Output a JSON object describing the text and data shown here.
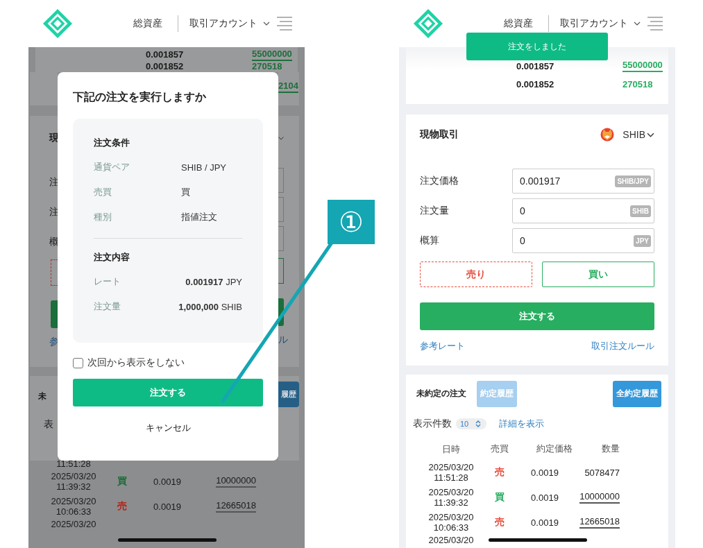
{
  "callout": {
    "label": "①"
  },
  "confirm_screen": {
    "header": {
      "nav": [
        "総資産",
        "取引アカウント"
      ]
    },
    "order_book": [
      {
        "price": "0.001857",
        "amount": "55000000",
        "link": true
      },
      {
        "price": "0.001852",
        "amount": "270518",
        "link": false
      }
    ],
    "left_edge": [
      "現",
      "注",
      "注",
      "概",
      "参",
      "未",
      "表"
    ],
    "right_edge": [
      "2104",
      "ル",
      "履歴"
    ],
    "dialog": {
      "title": "下記の注文を実行しますか",
      "sections": [
        {
          "heading": "注文条件",
          "rows": [
            {
              "label": "通貨ペア",
              "value": "SHIB / JPY"
            },
            {
              "label": "売買",
              "value": "買"
            },
            {
              "label": "種別",
              "value": "指値注文"
            }
          ]
        },
        {
          "heading": "注文内容",
          "rows": [
            {
              "label": "レート",
              "value": "**0.001917** JPY"
            },
            {
              "label": "注文量",
              "value": "**1,000,000** SHIB"
            }
          ]
        }
      ],
      "dont_show": {
        "label": "次回から表示をしない",
        "checked": false
      },
      "confirm": "注文する",
      "cancel": "キャンセル"
    },
    "table": {
      "partial_top": "11:51:28",
      "rows": [
        {
          "date": "2025/03/20",
          "time": "11:39:32",
          "side": "買",
          "kind": "buy",
          "price": "0.0019",
          "qty": "10000000",
          "link": true
        },
        {
          "date": "2025/03/20",
          "time": "10:06:33",
          "side": "売",
          "kind": "sell",
          "price": "0.0019",
          "qty": "12665018",
          "link": true
        }
      ],
      "partial_bottom": "2025/03/20"
    }
  },
  "result_screen": {
    "header": {
      "nav": [
        "総資産",
        "取引アカウント"
      ]
    },
    "toast": "注文をしました",
    "order_book": [
      {
        "price": "0.001857",
        "amount": "55000000",
        "link": true
      },
      {
        "price": "0.001852",
        "amount": "270518",
        "link": false
      }
    ],
    "trade": {
      "title": "現物取引",
      "coin": "SHIB",
      "fields": [
        {
          "label": "注文価格",
          "value": "0.001917",
          "unit": "SHIB/JPY"
        },
        {
          "label": "注文量",
          "value": "0",
          "unit": "SHIB"
        },
        {
          "label": "概算",
          "value": "0",
          "unit": "JPY"
        }
      ],
      "sides": [
        {
          "label": "売り",
          "kind": "sell",
          "selected": false
        },
        {
          "label": "買い",
          "kind": "buy",
          "selected": true
        }
      ],
      "submit": "注文する",
      "links": [
        "参考レート",
        "取引注文ルール"
      ]
    },
    "orders": {
      "title": "未約定の注文",
      "buttons": [
        {
          "label": "約定履歴",
          "disabled": true
        },
        {
          "label": "全約定履歴",
          "disabled": false
        }
      ],
      "page_size_label": "表示件数",
      "page_size": "10",
      "details_link": "詳細を表示",
      "columns": [
        "日時",
        "売買",
        "約定価格",
        "数量"
      ],
      "rows": [
        {
          "date": "2025/03/20",
          "time": "11:51:28",
          "side": "売",
          "kind": "sell",
          "price": "0.0019",
          "qty": "5078477",
          "link": false
        },
        {
          "date": "2025/03/20",
          "time": "11:39:32",
          "side": "買",
          "kind": "buy",
          "price": "0.0019",
          "qty": "10000000",
          "link": true
        },
        {
          "date": "2025/03/20",
          "time": "10:06:33",
          "side": "売",
          "kind": "sell",
          "price": "0.0019",
          "qty": "12665018",
          "link": true
        }
      ],
      "partial_bottom": "2025/03/20"
    }
  }
}
